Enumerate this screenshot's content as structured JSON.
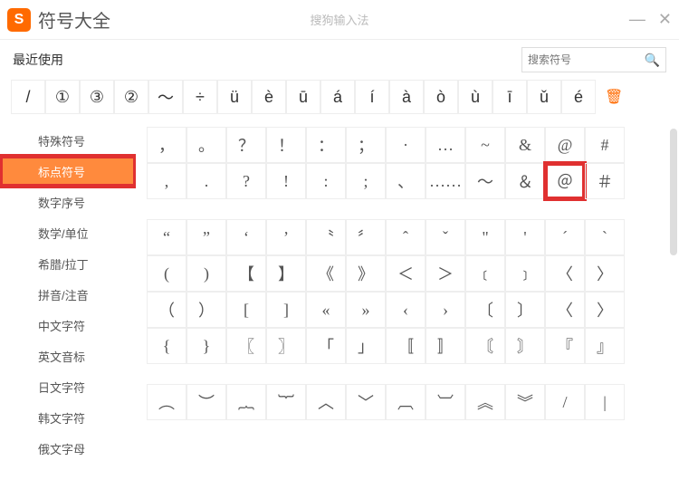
{
  "titlebar": {
    "logo_text": "S",
    "title": "符号大全",
    "subtitle": "搜狗输入法"
  },
  "toolbar": {
    "recent_label": "最近使用",
    "search_placeholder": "搜索符号"
  },
  "recent": [
    "/",
    "①",
    "③",
    "②",
    "～",
    "÷",
    "ü",
    "è",
    "ū",
    "á",
    "í",
    "à",
    "ò",
    "ù",
    "ī",
    "ǔ",
    "é"
  ],
  "sidebar": {
    "items": [
      "特殊符号",
      "标点符号",
      "数字序号",
      "数学/单位",
      "希腊/拉丁",
      "拼音/注音",
      "中文字符",
      "英文音标",
      "日文字符",
      "韩文字符",
      "俄文字母"
    ],
    "active_index": 1
  },
  "grids": [
    [
      [
        "，",
        "。",
        "？",
        "！",
        "：",
        "；",
        "·",
        "…",
        "~",
        "&",
        "@",
        "#"
      ],
      [
        ",",
        ".",
        "?",
        "!",
        ":",
        ";",
        "、",
        "……",
        "～",
        "＆",
        "＠",
        "＃"
      ]
    ],
    [
      [
        "“",
        "”",
        "‘",
        "’",
        "〝",
        "〞",
        "ˆ",
        "ˇ",
        "\"",
        "'",
        "´",
        "ˋ"
      ],
      [
        "(",
        ")",
        "【",
        "】",
        "《",
        "》",
        "＜",
        "＞",
        "﹝",
        "﹞",
        "〈",
        "〉"
      ],
      [
        "（",
        "）",
        "[",
        "]",
        "«",
        "»",
        "‹",
        "›",
        "〔",
        "〕",
        "〈",
        "〉"
      ],
      [
        "{",
        "}",
        "〖",
        "〗",
        "「",
        "」",
        "〚",
        "〛",
        "〘",
        "〙",
        "『",
        "』"
      ]
    ],
    [
      [
        "︵",
        "︶",
        "︷",
        "︸",
        "︿",
        "﹀",
        "︹",
        "︺",
        "︽",
        "︾",
        "/",
        "|"
      ]
    ]
  ],
  "highlight_cell": {
    "grid": 0,
    "row": 1,
    "col": 10
  }
}
